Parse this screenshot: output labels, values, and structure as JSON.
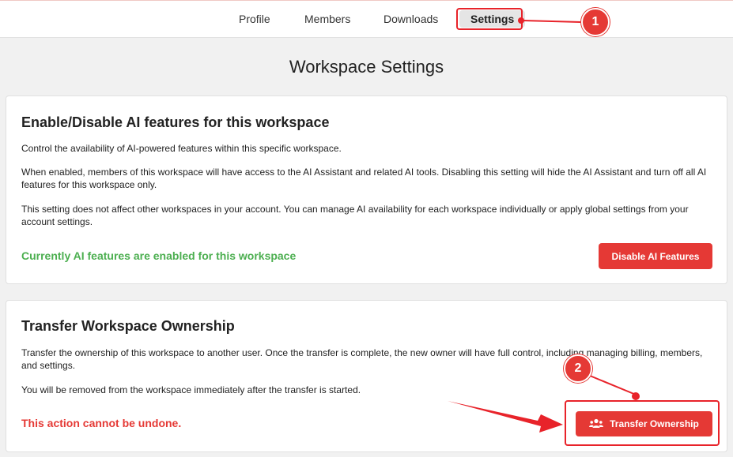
{
  "nav": {
    "tabs": [
      {
        "label": "Profile"
      },
      {
        "label": "Members"
      },
      {
        "label": "Downloads"
      },
      {
        "label": "Settings",
        "active": true
      }
    ]
  },
  "page": {
    "title": "Workspace Settings"
  },
  "ai_card": {
    "title": "Enable/Disable AI features for this workspace",
    "para1": "Control the availability of AI-powered features within this specific workspace.",
    "para2": "When enabled, members of this workspace will have access to the AI Assistant and related AI tools. Disabling this setting will hide the AI Assistant and turn off all AI features for this workspace only.",
    "para3": "This setting does not affect other workspaces in your account. You can manage AI availability for each workspace individually or apply global settings from your account settings.",
    "status": "Currently AI features are enabled for this workspace",
    "button_label": "Disable AI Features"
  },
  "transfer_card": {
    "title": "Transfer Workspace Ownership",
    "para1": "Transfer the ownership of this workspace to another user. Once the transfer is complete, the new owner will have full control, including managing billing, members, and settings.",
    "para2": "You will be removed from the workspace immediately after the transfer is started.",
    "warning": "This action cannot be undone.",
    "button_label": "Transfer Ownership",
    "button_icon": "users-icon"
  },
  "annotations": [
    {
      "number": "1"
    },
    {
      "number": "2"
    }
  ],
  "colors": {
    "accent_red": "#e53935",
    "success_green": "#4caf50",
    "annotation_red": "#e8232a"
  }
}
